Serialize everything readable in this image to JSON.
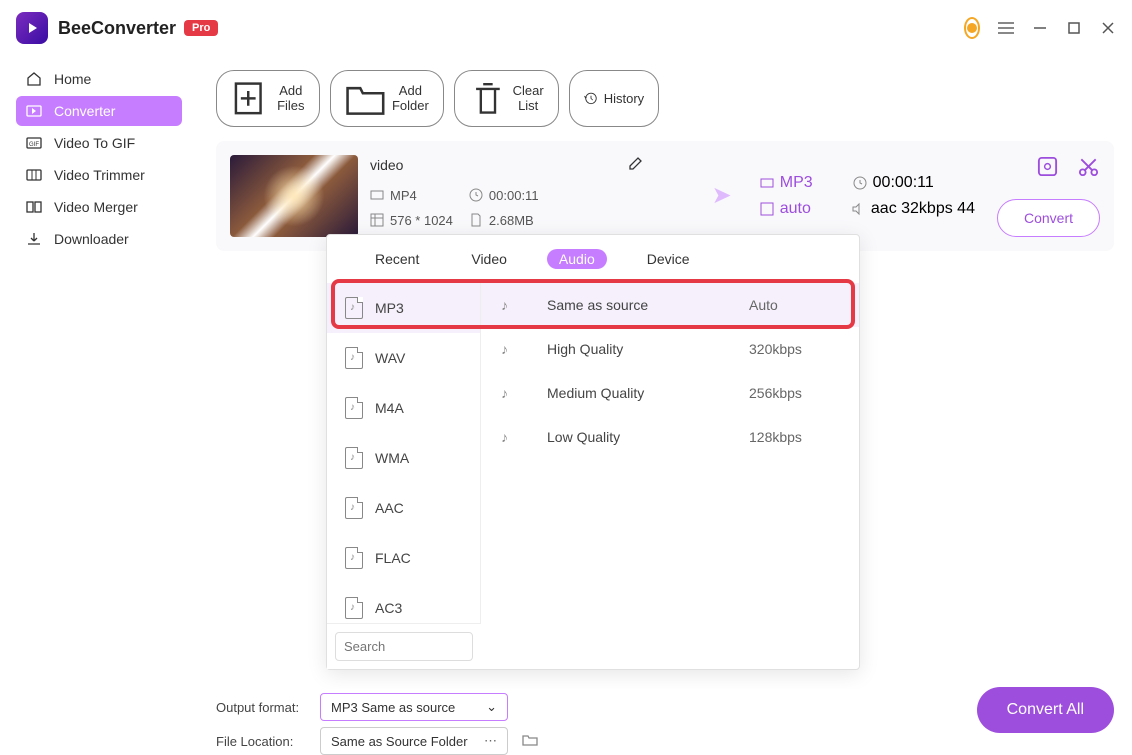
{
  "app": {
    "name": "BeeConverter",
    "badge": "Pro"
  },
  "sidebar": {
    "items": [
      {
        "label": "Home",
        "icon": "home"
      },
      {
        "label": "Converter",
        "icon": "converter"
      },
      {
        "label": "Video To GIF",
        "icon": "gif"
      },
      {
        "label": "Video Trimmer",
        "icon": "trimmer"
      },
      {
        "label": "Video Merger",
        "icon": "merger"
      },
      {
        "label": "Downloader",
        "icon": "download"
      }
    ]
  },
  "toolbar": {
    "add_files": "Add Files",
    "add_folder": "Add Folder",
    "clear_list": "Clear List",
    "history": "History"
  },
  "file": {
    "title": "video",
    "src_format": "MP4",
    "duration": "00:00:11",
    "dimensions": "576 * 1024",
    "size": "2.68MB",
    "dst_format": "MP3",
    "dst_duration": "00:00:11",
    "dst_profile": "auto",
    "dst_audio": "aac 32kbps 44",
    "convert_label": "Convert"
  },
  "popup": {
    "tabs": {
      "recent": "Recent",
      "video": "Video",
      "audio": "Audio",
      "device": "Device"
    },
    "formats": [
      "MP3",
      "WAV",
      "M4A",
      "WMA",
      "AAC",
      "FLAC",
      "AC3"
    ],
    "search_placeholder": "Search",
    "qualities": [
      {
        "label": "Same as source",
        "value": "Auto"
      },
      {
        "label": "High Quality",
        "value": "320kbps"
      },
      {
        "label": "Medium Quality",
        "value": "256kbps"
      },
      {
        "label": "Low Quality",
        "value": "128kbps"
      }
    ]
  },
  "footer": {
    "output_format_label": "Output format:",
    "output_format_value": "MP3 Same as source",
    "file_location_label": "File Location:",
    "file_location_value": "Same as Source Folder",
    "convert_all": "Convert All"
  }
}
